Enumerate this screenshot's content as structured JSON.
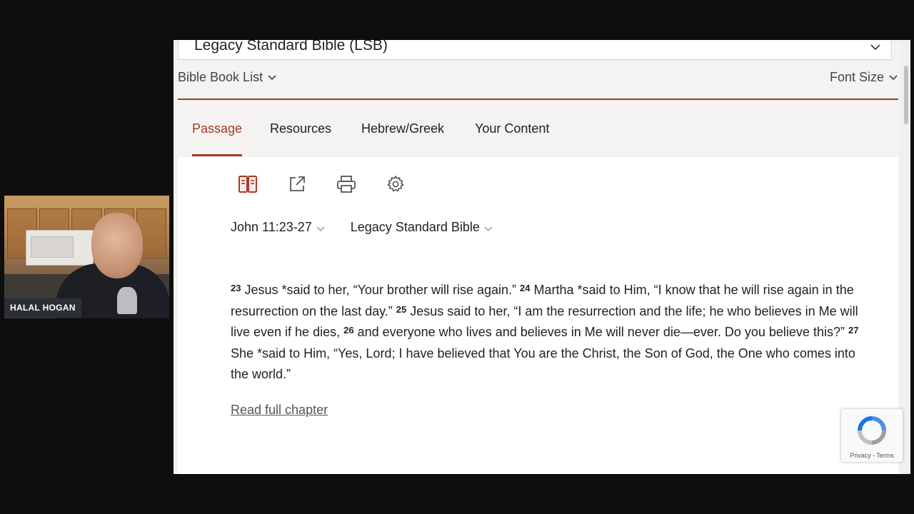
{
  "webcam": {
    "name": "HALAL HOGAN"
  },
  "header": {
    "version_selected": "Legacy Standard Bible (LSB)",
    "book_list_label": "Bible Book List",
    "font_size_label": "Font Size"
  },
  "tabs": [
    {
      "label": "Passage",
      "active": true
    },
    {
      "label": "Resources",
      "active": false
    },
    {
      "label": "Hebrew/Greek",
      "active": false
    },
    {
      "label": "Your Content",
      "active": false
    }
  ],
  "tools": [
    "parallel-view-icon",
    "share-icon",
    "print-icon",
    "gear-icon"
  ],
  "reference": {
    "passage": "John 11:23-27",
    "version": "Legacy Standard Bible"
  },
  "passage": {
    "verses": [
      {
        "num": "23",
        "text": "Jesus *said to her, “Your brother will rise again.”"
      },
      {
        "num": "24",
        "text": "Martha *said to Him, “I know that he will rise again in the resurrection on the last day.”"
      },
      {
        "num": "25",
        "text": "Jesus said to her, “I am the resurrection and the life; he who believes in Me will live even if he dies,"
      },
      {
        "num": "26",
        "text": "and everyone who lives and believes in Me will never die—ever. Do you believe this?”"
      },
      {
        "num": "27",
        "text": "She *said to Him, “Yes, Lord; I have believed that You are the Christ, the Son of God, the One who comes into the world.”"
      }
    ],
    "read_full_label": "Read full chapter"
  },
  "recaptcha": {
    "terms": "Privacy - Terms"
  },
  "colors": {
    "accent": "#a53a25",
    "rule": "#9a3b2a"
  }
}
